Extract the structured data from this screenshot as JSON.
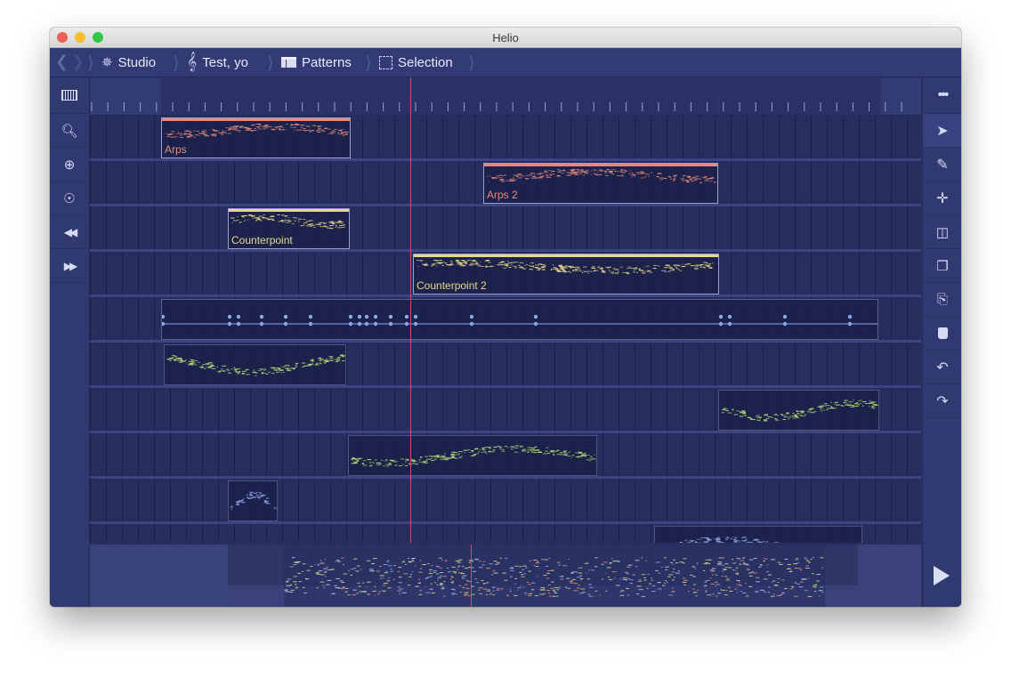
{
  "window": {
    "title": "Helio"
  },
  "breadcrumbs": [
    {
      "label": "Studio",
      "icon": "studio-icon"
    },
    {
      "label": "Test, yo",
      "icon": "treble-clef-icon"
    },
    {
      "label": "Patterns",
      "icon": "patterns-icon"
    },
    {
      "label": "Selection",
      "icon": "selection-icon"
    }
  ],
  "left_toolbar": [
    "piano-keys-icon",
    "zoom-out-icon",
    "zoom-in-icon",
    "zoom-fit-icon",
    "rewind-icon",
    "fast-forward-icon"
  ],
  "right_toolbar": [
    "more-icon",
    "cursor-icon",
    "pen-icon",
    "move-icon",
    "split-icon",
    "copy-icon",
    "paste-icon",
    "delete-icon",
    "undo-icon",
    "redo-icon"
  ],
  "clips": [
    {
      "label": "Arps",
      "color": "#e58a7a"
    },
    {
      "label": "Arps 2",
      "color": "#e58a7a"
    },
    {
      "label": "Counterpoint",
      "color": "#e8d98a"
    },
    {
      "label": "Counterpoint 2",
      "color": "#e8d98a"
    }
  ],
  "colors": {
    "background": "#2c3466",
    "accent_red": "#e58a7a",
    "accent_yellow": "#e8d98a",
    "accent_green": "#b7e07a",
    "accent_blue": "#8ea7e8",
    "playhead": "#d14a6a"
  }
}
